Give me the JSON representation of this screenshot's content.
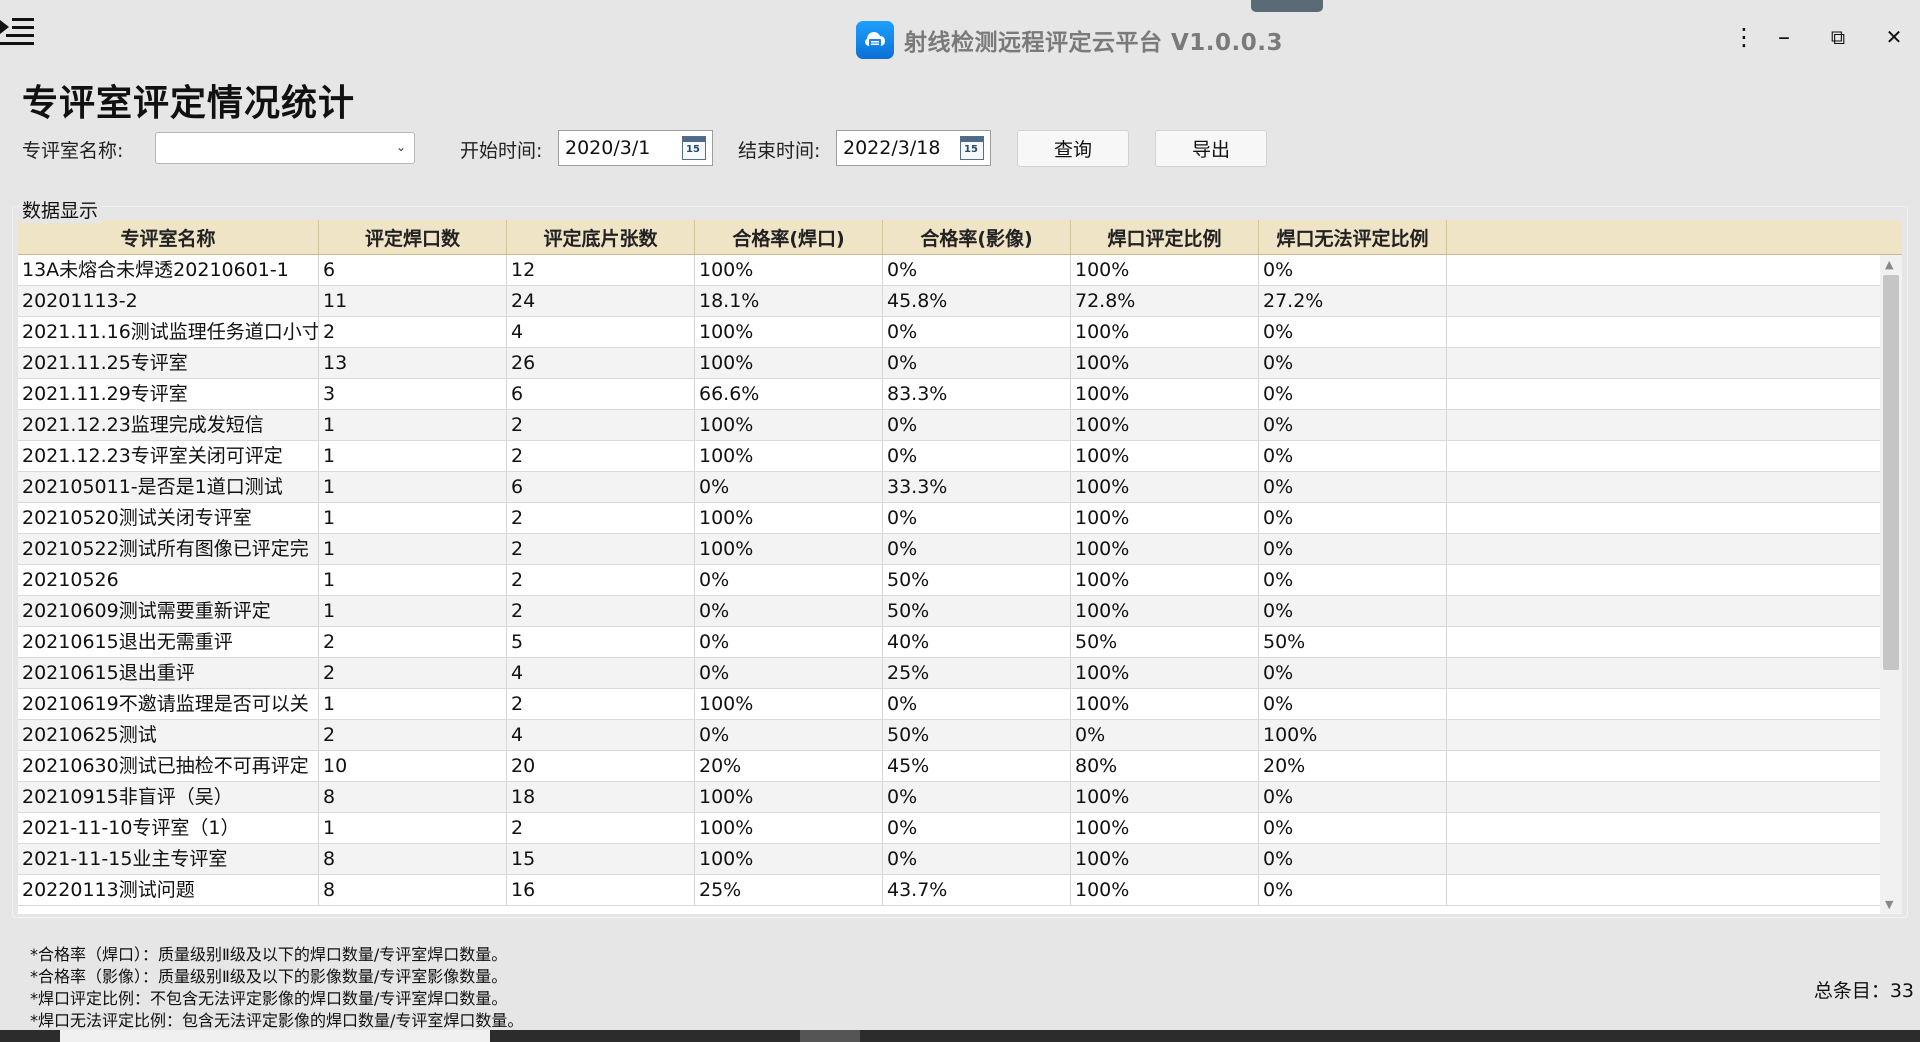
{
  "app": {
    "title": "射线检测远程评定云平台 V1.0.0.3"
  },
  "window_controls": {
    "more": "⋮",
    "minimize": "–",
    "restore": "⧉",
    "close": "✕"
  },
  "page": {
    "title": "专评室评定情况统计"
  },
  "filters": {
    "room_label": "专评室名称:",
    "room_value": "",
    "start_label": "开始时间:",
    "start_value": "2020/3/1",
    "end_label": "结束时间:",
    "end_value": "2022/3/18",
    "calendar_num": "15",
    "query_button": "查询",
    "export_button": "导出"
  },
  "group": {
    "label": "数据显示"
  },
  "table": {
    "columns": [
      "专评室名称",
      "评定焊口数",
      "评定底片张数",
      "合格率(焊口)",
      "合格率(影像)",
      "焊口评定比例",
      "焊口无法评定比例"
    ],
    "rows": [
      [
        "13A未熔合未焊透20210601-1",
        "6",
        "12",
        "100%",
        "0%",
        "100%",
        "0%"
      ],
      [
        "20201113-2",
        "11",
        "24",
        "18.1%",
        "45.8%",
        "72.8%",
        "27.2%"
      ],
      [
        "2021.11.16测试监理任务道口小寸",
        "2",
        "4",
        "100%",
        "0%",
        "100%",
        "0%"
      ],
      [
        "2021.11.25专评室",
        "13",
        "26",
        "100%",
        "0%",
        "100%",
        "0%"
      ],
      [
        "2021.11.29专评室",
        "3",
        "6",
        "66.6%",
        "83.3%",
        "100%",
        "0%"
      ],
      [
        "2021.12.23监理完成发短信",
        "1",
        "2",
        "100%",
        "0%",
        "100%",
        "0%"
      ],
      [
        "2021.12.23专评室关闭可评定",
        "1",
        "2",
        "100%",
        "0%",
        "100%",
        "0%"
      ],
      [
        "202105011-是否是1道口测试",
        "1",
        "6",
        "0%",
        "33.3%",
        "100%",
        "0%"
      ],
      [
        "20210520测试关闭专评室",
        "1",
        "2",
        "100%",
        "0%",
        "100%",
        "0%"
      ],
      [
        "20210522测试所有图像已评定完",
        "1",
        "2",
        "100%",
        "0%",
        "100%",
        "0%"
      ],
      [
        "20210526",
        "1",
        "2",
        "0%",
        "50%",
        "100%",
        "0%"
      ],
      [
        "20210609测试需要重新评定",
        "1",
        "2",
        "0%",
        "50%",
        "100%",
        "0%"
      ],
      [
        "20210615退出无需重评",
        "2",
        "5",
        "0%",
        "40%",
        "50%",
        "50%"
      ],
      [
        "20210615退出重评",
        "2",
        "4",
        "0%",
        "25%",
        "100%",
        "0%"
      ],
      [
        "20210619不邀请监理是否可以关",
        "1",
        "2",
        "100%",
        "0%",
        "100%",
        "0%"
      ],
      [
        "20210625测试",
        "2",
        "4",
        "0%",
        "50%",
        "0%",
        "100%"
      ],
      [
        "20210630测试已抽检不可再评定",
        "10",
        "20",
        "20%",
        "45%",
        "80%",
        "20%"
      ],
      [
        "20210915非盲评（吴）",
        "8",
        "18",
        "100%",
        "0%",
        "100%",
        "0%"
      ],
      [
        "2021-11-10专评室（1）",
        "1",
        "2",
        "100%",
        "0%",
        "100%",
        "0%"
      ],
      [
        "2021-11-15业主专评室",
        "8",
        "15",
        "100%",
        "0%",
        "100%",
        "0%"
      ],
      [
        "20220113测试问题",
        "8",
        "16",
        "25%",
        "43.7%",
        "100%",
        "0%"
      ]
    ]
  },
  "notes": [
    "*合格率（焊口）：质量级别Ⅱ级及以下的焊口数量/专评室焊口数量。",
    "*合格率（影像）：质量级别Ⅱ级及以下的影像数量/专评室影像数量。",
    "*焊口评定比例：不包含无法评定影像的焊口数量/专评室焊口数量。",
    "*焊口无法评定比例：包含无法评定影像的焊口数量/专评室焊口数量。"
  ],
  "footer": {
    "total": "总条目：33"
  }
}
